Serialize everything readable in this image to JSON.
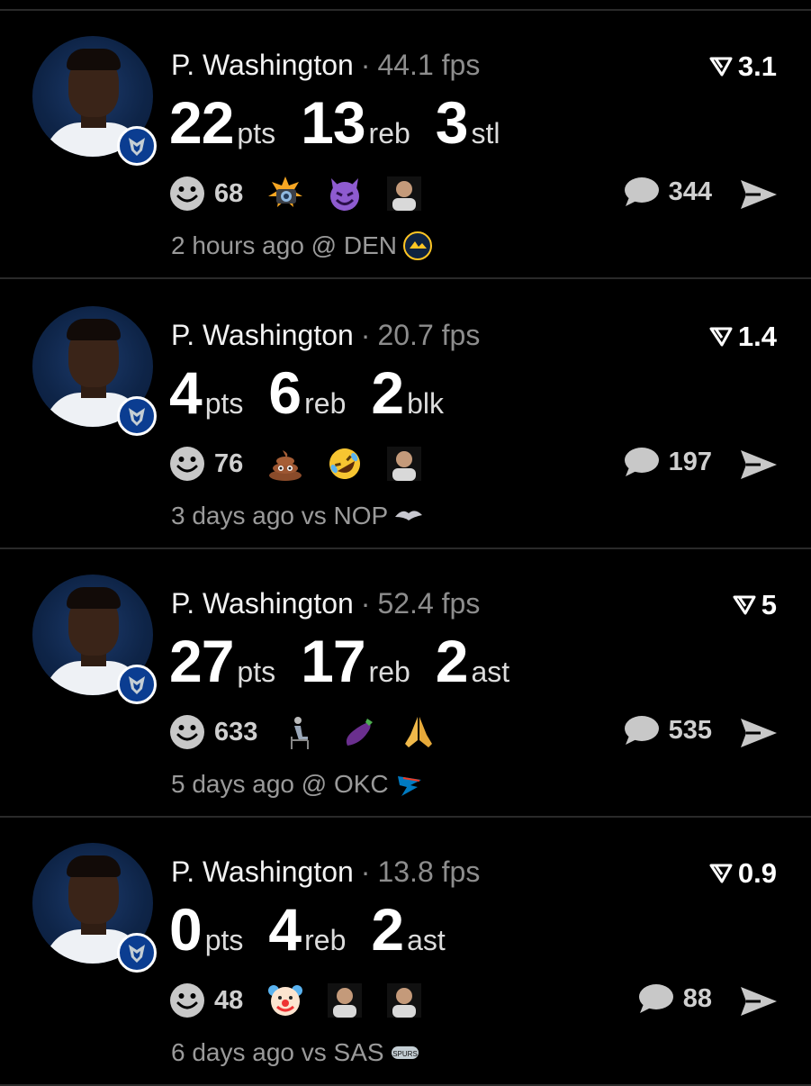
{
  "posts": [
    {
      "player": "P. Washington",
      "separator": "·",
      "fps": "44.1 fps",
      "score": "3.1",
      "stats": [
        {
          "value": "22",
          "label": "pts"
        },
        {
          "value": "13",
          "label": "reb"
        },
        {
          "value": "3",
          "label": "stl"
        }
      ],
      "reaction_count": "68",
      "reaction_icons": [
        "explosion-camera-icon",
        "smiling-devil-icon",
        "person-photo-icon"
      ],
      "comment_count": "344",
      "time": "2 hours ago @ DEN",
      "opponent_logo": "nuggets-logo-icon"
    },
    {
      "player": "P. Washington",
      "separator": "·",
      "fps": "20.7 fps",
      "score": "1.4",
      "stats": [
        {
          "value": "4",
          "label": "pts"
        },
        {
          "value": "6",
          "label": "reb"
        },
        {
          "value": "2",
          "label": "blk"
        }
      ],
      "reaction_count": "76",
      "reaction_icons": [
        "poop-icon",
        "rofl-icon",
        "person-photo-icon"
      ],
      "comment_count": "197",
      "time": "3 days ago vs NOP",
      "opponent_logo": "pelicans-logo-icon"
    },
    {
      "player": "P. Washington",
      "separator": "·",
      "fps": "52.4 fps",
      "score": "5",
      "stats": [
        {
          "value": "27",
          "label": "pts"
        },
        {
          "value": "17",
          "label": "reb"
        },
        {
          "value": "2",
          "label": "ast"
        }
      ],
      "reaction_count": "633",
      "reaction_icons": [
        "person-chair-icon",
        "eggplant-icon",
        "praying-hands-icon"
      ],
      "comment_count": "535",
      "time": "5 days ago @ OKC",
      "opponent_logo": "thunder-logo-icon"
    },
    {
      "player": "P. Washington",
      "separator": "·",
      "fps": "13.8 fps",
      "score": "0.9",
      "stats": [
        {
          "value": "0",
          "label": "pts"
        },
        {
          "value": "4",
          "label": "reb"
        },
        {
          "value": "2",
          "label": "ast"
        }
      ],
      "reaction_count": "48",
      "reaction_icons": [
        "clown-icon",
        "person-photo-icon",
        "person-photo-icon"
      ],
      "comment_count": "88",
      "time": "6 days ago vs SAS",
      "opponent_logo": "spurs-logo-icon"
    }
  ],
  "colors": {
    "background": "#000000",
    "divider": "#2a2a2a",
    "muted": "#8d8d8d",
    "mavs_blue": "#0b3d91"
  }
}
